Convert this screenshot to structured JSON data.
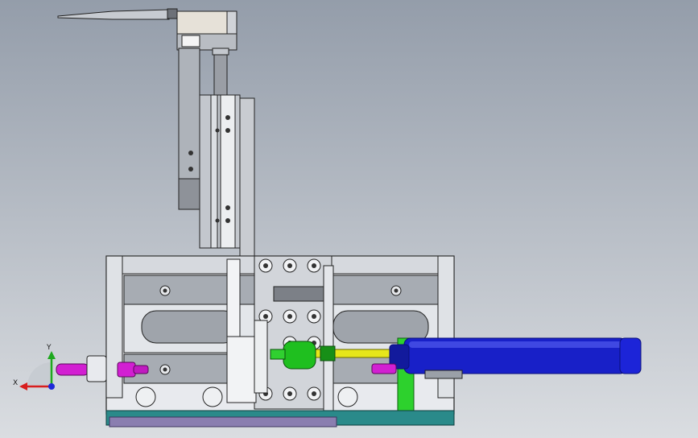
{
  "view": {
    "background_top": "#949daa",
    "background_bottom": "#dadde1"
  },
  "parts": {
    "frame_color": "#e8eaee",
    "steel_color": "#a9aeb5",
    "dark_steel_color": "#7d828a",
    "cylinder_color": "#1820c8",
    "cylinder_dark": "#0a0f7a",
    "coupler_color": "#1fbf1f",
    "piston_rod_color": "#e6e61a",
    "fitting_color": "#d21fd2",
    "green_plate_color": "#2dd12d",
    "base_teal_color": "#2a8a8a",
    "base_violet_color": "#8a7eb0"
  },
  "triad": {
    "x_label": "X",
    "y_label": "Y",
    "x_color": "#d81e1e",
    "y_color": "#1ea81e",
    "z_color": "#1e2ad8"
  }
}
